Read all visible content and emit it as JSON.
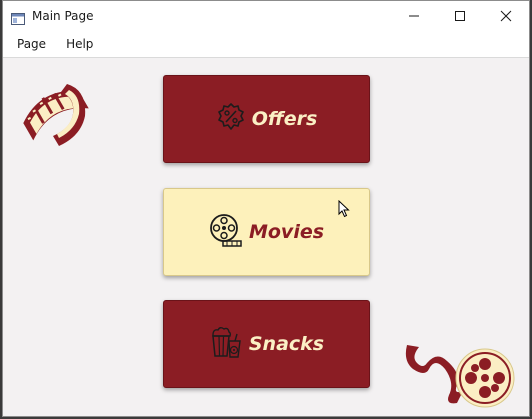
{
  "window": {
    "title": "Main Page",
    "icon": "app-window-icon",
    "caption_buttons": [
      "minimize-icon",
      "maximize-icon",
      "close-icon"
    ]
  },
  "menu": {
    "items": [
      {
        "label": "Page"
      },
      {
        "label": "Help"
      }
    ]
  },
  "buttons": {
    "offers": {
      "label": "Offers",
      "icon": "discount-badge-icon",
      "bg": "#8b1d24",
      "fg": "#fbf0c5"
    },
    "movies": {
      "label": "Movies",
      "icon": "film-reel-icon",
      "bg": "#fdf1bb",
      "fg": "#8b1d24"
    },
    "snacks": {
      "label": "Snacks",
      "icon": "popcorn-soda-icon",
      "bg": "#8b1d24",
      "fg": "#fbf0c5"
    }
  },
  "decorations": [
    "film-strip-icon",
    "film-reel-with-strip-icon"
  ],
  "colors": {
    "accent": "#8b1d24",
    "cream": "#fdf1bb",
    "background": "#f3f1f2"
  }
}
